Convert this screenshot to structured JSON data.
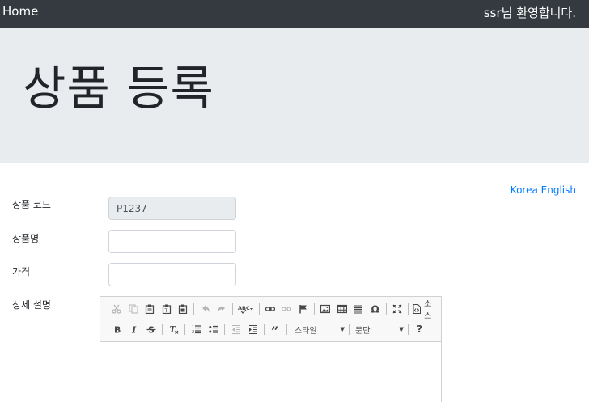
{
  "navbar": {
    "home": "Home",
    "welcome": "ssr님 환영합니다."
  },
  "jumbotron": {
    "title": "상품 등록"
  },
  "language": {
    "korea": "Korea",
    "english": "English"
  },
  "form": {
    "product_code_label": "상품 코드",
    "product_code_value": "P1237",
    "product_name_label": "상품명",
    "product_name_value": "",
    "price_label": "가격",
    "price_value": "",
    "description_label": "상세 설명"
  },
  "editor": {
    "source_label": "소스",
    "style_combo": "스타일",
    "paragraph_combo": "문단",
    "icons_row1": [
      "cut-icon",
      "copy-icon",
      "paste-icon",
      "paste-text-icon",
      "paste-word-icon",
      "undo-icon",
      "redo-icon",
      "spellcheck-icon",
      "link-icon",
      "unlink-icon",
      "anchor-icon",
      "image-icon",
      "table-icon",
      "horizontal-rule-icon",
      "special-char-icon",
      "maximize-icon",
      "source-icon"
    ],
    "icons_row2": [
      "bold-icon",
      "italic-icon",
      "strike-icon",
      "remove-format-icon",
      "numbered-list-icon",
      "bulleted-list-icon",
      "outdent-icon",
      "indent-icon",
      "blockquote-icon",
      "help-icon"
    ]
  }
}
